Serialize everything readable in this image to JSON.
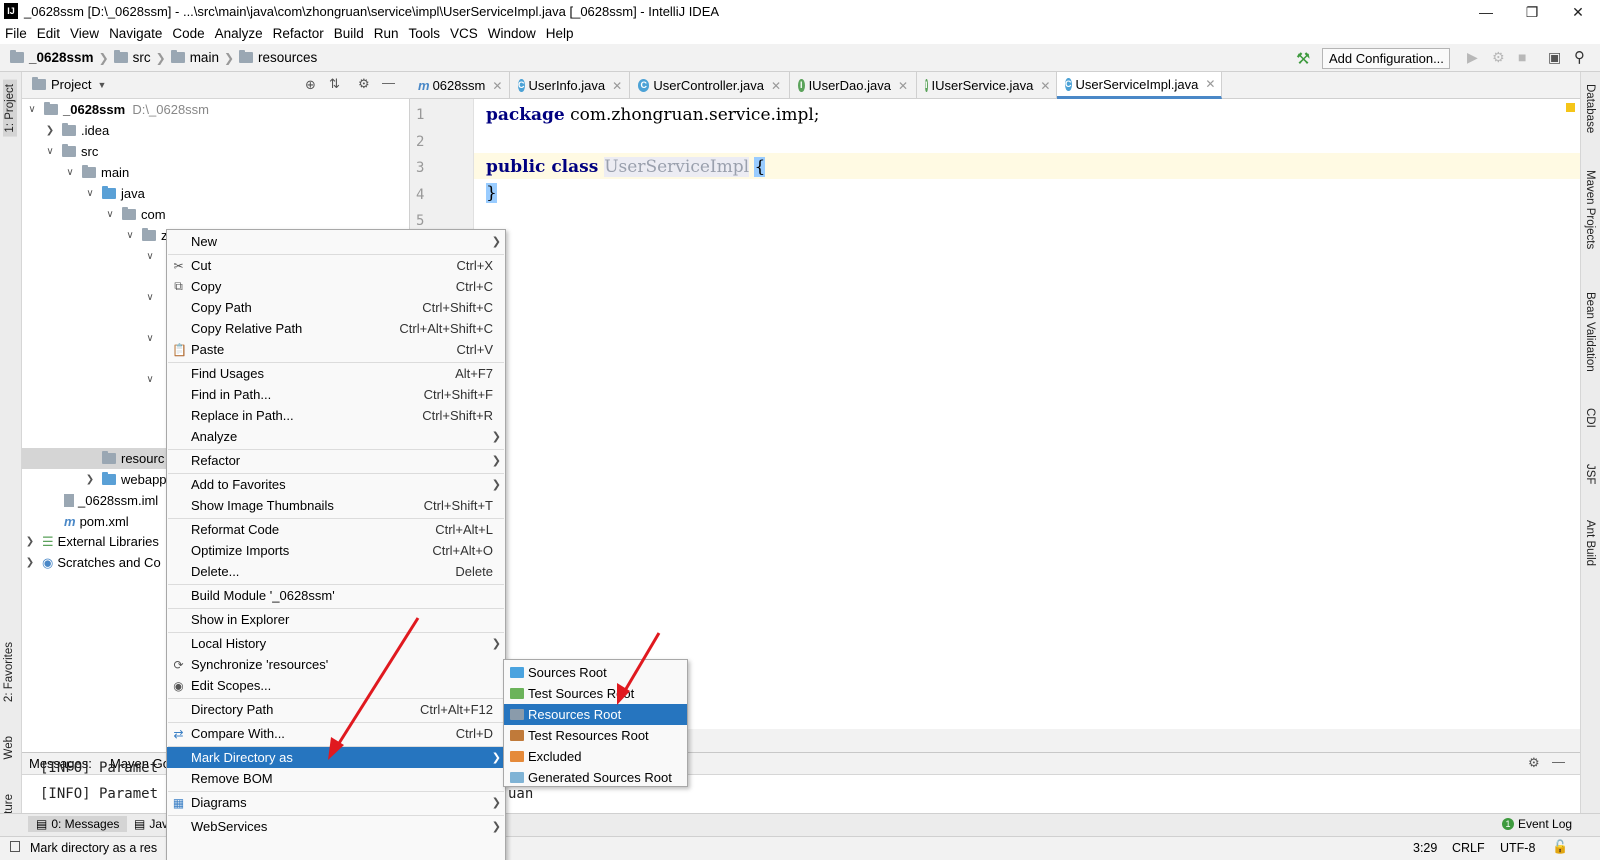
{
  "window": {
    "title": "_0628ssm [D:\\_0628ssm] - ...\\src\\main\\java\\com\\zhongruan\\service\\impl\\UserServiceImpl.java [_0628ssm] - IntelliJ IDEA",
    "logo": "IJ"
  },
  "menubar": [
    "File",
    "Edit",
    "View",
    "Navigate",
    "Code",
    "Analyze",
    "Refactor",
    "Build",
    "Run",
    "Tools",
    "VCS",
    "Window",
    "Help"
  ],
  "breadcrumb": [
    "_0628ssm",
    "src",
    "main",
    "resources"
  ],
  "toolbar": {
    "add_config": "Add Configuration..."
  },
  "left_tabs": {
    "project": "1: Project",
    "favorites": "2: Favorites",
    "web": "Web",
    "structure": "7: Structure"
  },
  "right_tabs": [
    "Database",
    "Maven Projects",
    "Bean Validation",
    "CDI",
    "JSF",
    "Ant Build"
  ],
  "project_panel": {
    "title": "Project",
    "tree": [
      {
        "label": "_0628ssm",
        "extra": "D:\\_0628ssm"
      },
      {
        "label": ".idea"
      },
      {
        "label": "src"
      },
      {
        "label": "main"
      },
      {
        "label": "java"
      },
      {
        "label": "com"
      },
      {
        "label": "z"
      },
      {
        "label": "resourc"
      },
      {
        "label": "webapp"
      },
      {
        "label": "_0628ssm.iml"
      },
      {
        "label": "pom.xml"
      },
      {
        "label": "External Libraries"
      },
      {
        "label": "Scratches and Co"
      }
    ]
  },
  "editor_tabs": [
    {
      "label": "0628ssm",
      "icon": "m"
    },
    {
      "label": "UserInfo.java",
      "icon": "C"
    },
    {
      "label": "UserController.java",
      "icon": "C"
    },
    {
      "label": "IUserDao.java",
      "icon": "I"
    },
    {
      "label": "IUserService.java",
      "icon": "I"
    },
    {
      "label": "UserServiceImpl.java",
      "icon": "C"
    }
  ],
  "editor": {
    "line_numbers": [
      "1",
      "2",
      "3",
      "4",
      "5"
    ],
    "line1_kw": "package",
    "line1_rest": " com.zhongruan.service.impl;",
    "line3_kw": "public class ",
    "line3_class": "UserServiceImpl",
    "open_brace": "{",
    "close_brace": "}"
  },
  "messages_panel": {
    "tabs": [
      "Messages:",
      "Maven Go"
    ],
    "lines": [
      "[INFO] Paramet",
      "[INFO] Paramet"
    ],
    "right_text": "uan"
  },
  "bottom_bar": {
    "messages": "0: Messages",
    "java": "Jav",
    "event_log": "Event Log"
  },
  "status": {
    "message": "Mark directory as a res",
    "position": "3:29",
    "line_sep": "CRLF",
    "encoding": "UTF-8"
  },
  "context_menu": {
    "items": [
      {
        "label": "New",
        "shortcut": "",
        "submenu": true
      },
      {
        "label": "Cut",
        "shortcut": "Ctrl+X",
        "icon": "scissors-icon"
      },
      {
        "label": "Copy",
        "shortcut": "Ctrl+C",
        "icon": "copy-icon"
      },
      {
        "label": "Copy Path",
        "shortcut": "Ctrl+Shift+C"
      },
      {
        "label": "Copy Relative Path",
        "shortcut": "Ctrl+Alt+Shift+C"
      },
      {
        "label": "Paste",
        "shortcut": "Ctrl+V",
        "icon": "clipboard-icon"
      },
      {
        "label": "Find Usages",
        "shortcut": "Alt+F7"
      },
      {
        "label": "Find in Path...",
        "shortcut": "Ctrl+Shift+F"
      },
      {
        "label": "Replace in Path...",
        "shortcut": "Ctrl+Shift+R"
      },
      {
        "label": "Analyze",
        "shortcut": "",
        "submenu": true
      },
      {
        "label": "Refactor",
        "shortcut": "",
        "submenu": true
      },
      {
        "label": "Add to Favorites",
        "shortcut": "",
        "submenu": true
      },
      {
        "label": "Show Image Thumbnails",
        "shortcut": "Ctrl+Shift+T"
      },
      {
        "label": "Reformat Code",
        "shortcut": "Ctrl+Alt+L"
      },
      {
        "label": "Optimize Imports",
        "shortcut": "Ctrl+Alt+O"
      },
      {
        "label": "Delete...",
        "shortcut": "Delete"
      },
      {
        "label": "Build Module '_0628ssm'",
        "shortcut": ""
      },
      {
        "label": "Show in Explorer",
        "shortcut": ""
      },
      {
        "label": "Local History",
        "shortcut": "",
        "submenu": true
      },
      {
        "label": "Synchronize 'resources'",
        "shortcut": "",
        "icon": "sync-icon"
      },
      {
        "label": "Edit Scopes...",
        "shortcut": "",
        "icon": "scope-icon"
      },
      {
        "label": "Directory Path",
        "shortcut": "Ctrl+Alt+F12"
      },
      {
        "label": "Compare With...",
        "shortcut": "Ctrl+D",
        "icon": "compare-icon"
      },
      {
        "label": "Mark Directory as",
        "shortcut": "",
        "submenu": true,
        "selected": true
      },
      {
        "label": "Remove BOM",
        "shortcut": ""
      },
      {
        "label": "Diagrams",
        "shortcut": "",
        "submenu": true,
        "icon": "diagram-icon"
      },
      {
        "label": "WebServices",
        "shortcut": "",
        "submenu": true
      }
    ]
  },
  "mark_submenu": {
    "items": [
      {
        "label": "Sources Root",
        "color": "#4aa3df"
      },
      {
        "label": "Test Sources Root",
        "color": "#6bb35a"
      },
      {
        "label": "Resources Root",
        "color": "#8a9bab",
        "selected": true
      },
      {
        "label": "Test Resources Root",
        "color": "#c07a3a"
      },
      {
        "label": "Excluded",
        "color": "#e58a3a"
      },
      {
        "label": "Generated Sources Root",
        "color": "#7fb3d5"
      }
    ]
  },
  "colors": {
    "accent": "#2675bf",
    "annotation_arrow": "#e0191f"
  }
}
